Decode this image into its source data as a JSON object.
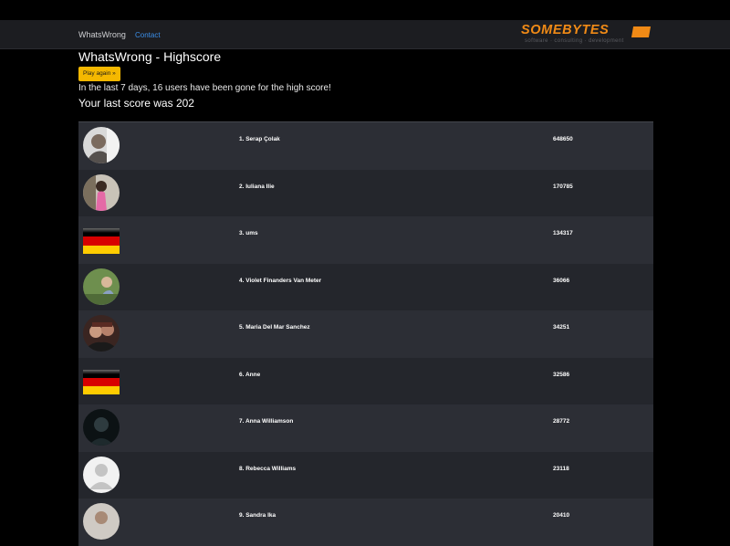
{
  "nav": {
    "brand": "WhatsWrong",
    "contact": "Contact",
    "logo_text": "SOMEBYTES",
    "logo_tagline": "software · consulting · development",
    "accent_color": "#f08a16"
  },
  "page": {
    "title": "WhatsWrong - Highscore",
    "play_button": "Play again »",
    "stats_text": "In the last 7 days, 16 users have been gone for the high score!",
    "last_score_text": "Your last score was 202"
  },
  "scores": [
    {
      "rank_name": "1. Serap Çolak",
      "score": "648650",
      "avatar": "photo"
    },
    {
      "rank_name": "2. Iuliana Ilie",
      "score": "170785",
      "avatar": "photo"
    },
    {
      "rank_name": "3. ums",
      "score": "134317",
      "avatar": "flag-de"
    },
    {
      "rank_name": "4. Violet Finanders Van Meter",
      "score": "36066",
      "avatar": "photo"
    },
    {
      "rank_name": "5. Maria Del Mar Sanchez",
      "score": "34251",
      "avatar": "photo"
    },
    {
      "rank_name": "6. Anne",
      "score": "32586",
      "avatar": "flag-de"
    },
    {
      "rank_name": "7. Anna Williamson",
      "score": "28772",
      "avatar": "photo"
    },
    {
      "rank_name": "8. Rebecca Williams",
      "score": "23118",
      "avatar": "default-user-icon"
    },
    {
      "rank_name": "9. Sandra Ika",
      "score": "20410",
      "avatar": "photo"
    }
  ]
}
